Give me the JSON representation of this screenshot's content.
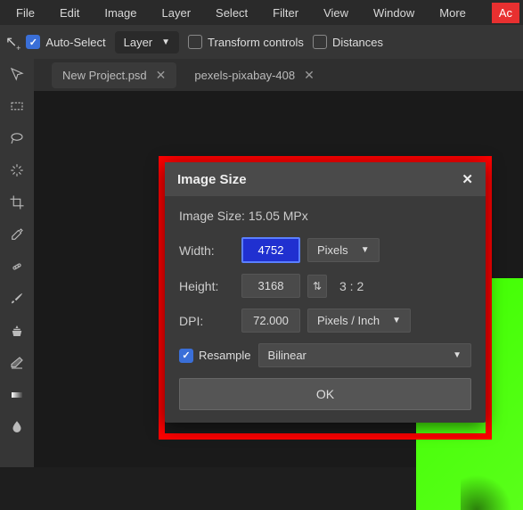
{
  "menu": {
    "items": [
      "File",
      "Edit",
      "Image",
      "Layer",
      "Select",
      "Filter",
      "View",
      "Window",
      "More"
    ],
    "account": "Ac"
  },
  "options": {
    "auto_select_label": "Auto-Select",
    "auto_select_checked": true,
    "layer_sel": "Layer",
    "transform_label": "Transform controls",
    "transform_checked": false,
    "distances_label": "Distances",
    "distances_checked": false
  },
  "tabs": [
    {
      "label": "New Project.psd",
      "active": true
    },
    {
      "label": "pexels-pixabay-408",
      "active": false
    }
  ],
  "dialog": {
    "title": "Image Size",
    "info_label": "Image Size:",
    "info_value": "15.05 MPx",
    "width_label": "Width:",
    "width_value": "4752",
    "width_unit": "Pixels",
    "height_label": "Height:",
    "height_value": "3168",
    "ratio": "3 : 2",
    "dpi_label": "DPI:",
    "dpi_value": "72.000",
    "dpi_unit": "Pixels / Inch",
    "resample_label": "Resample",
    "resample_checked": true,
    "resample_method": "Bilinear",
    "ok": "OK"
  }
}
